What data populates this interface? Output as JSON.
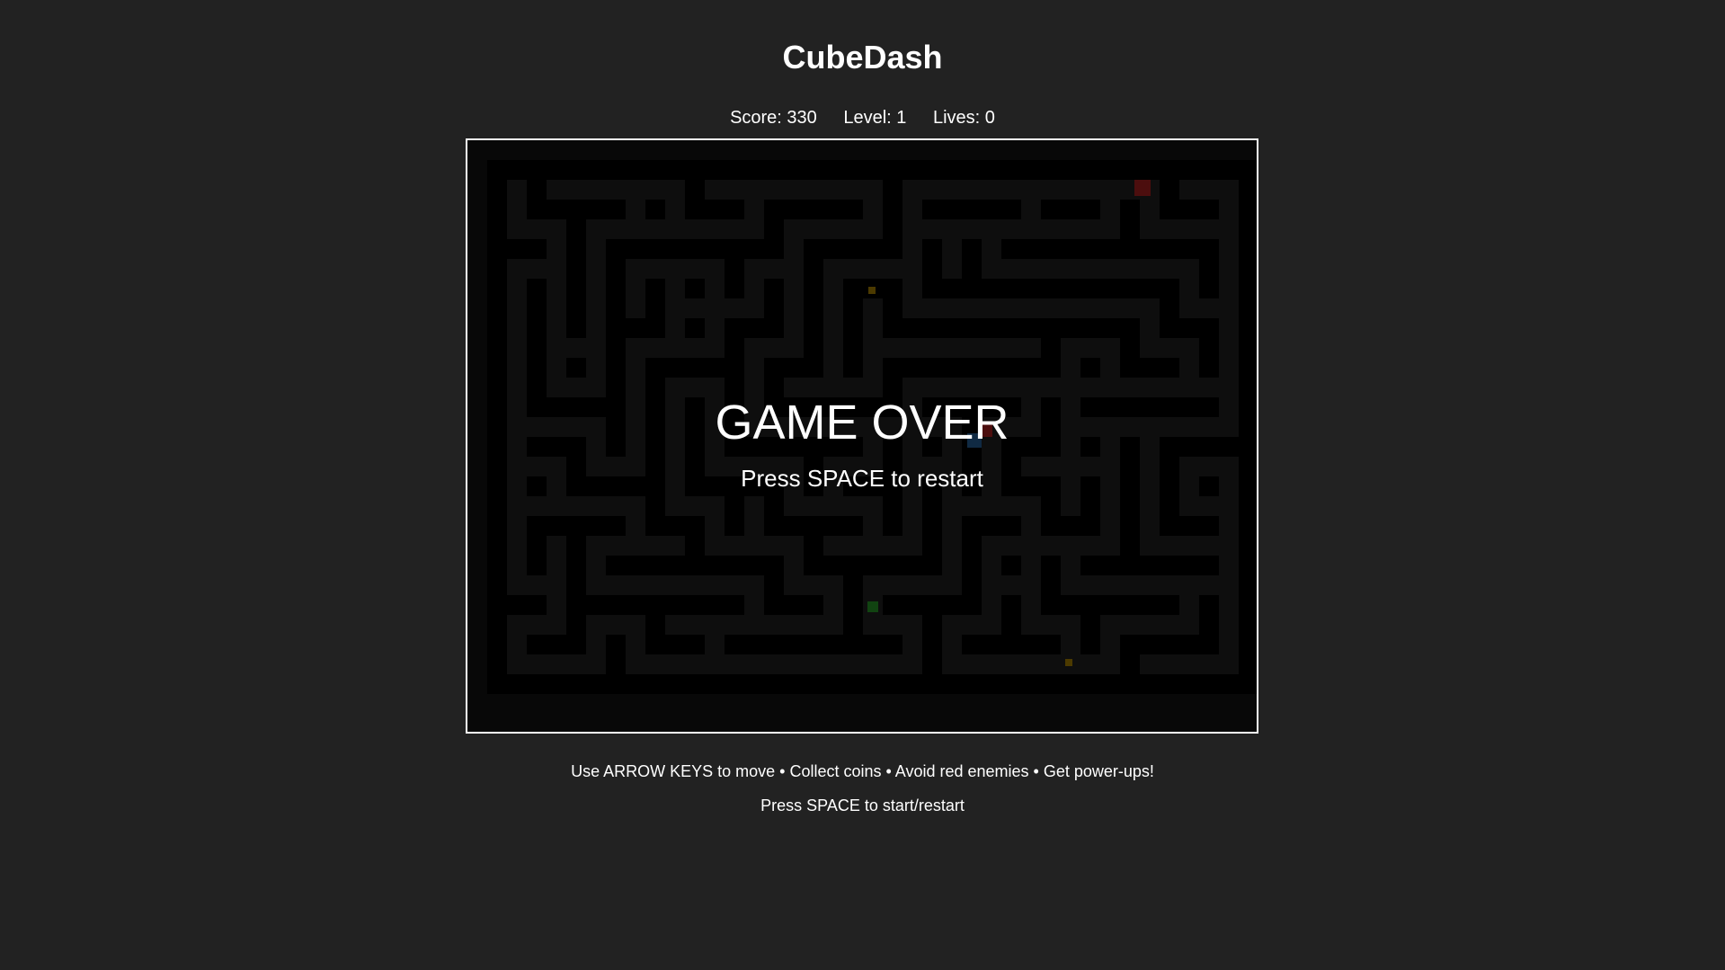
{
  "title": "CubeDash",
  "hud": {
    "score_label": "Score: 330",
    "level_label": "Level: 1",
    "lives_label": "Lives: 0"
  },
  "game": {
    "state": "game-over",
    "overlay_title": "GAME OVER",
    "overlay_subtitle": "Press SPACE to restart",
    "colors": {
      "background": "#222222",
      "board": "#101010",
      "wall": "#000000",
      "enemy": "#8b1a1a",
      "coin": "#8a6a00",
      "powerup": "#1f7a1f",
      "player": "#1e4e7a"
    }
  },
  "instructions": {
    "line1": "Use ARROW KEYS to move • Collect coins • Avoid red enemies • Get power-ups!",
    "line2": "Press SPACE to start/restart"
  }
}
